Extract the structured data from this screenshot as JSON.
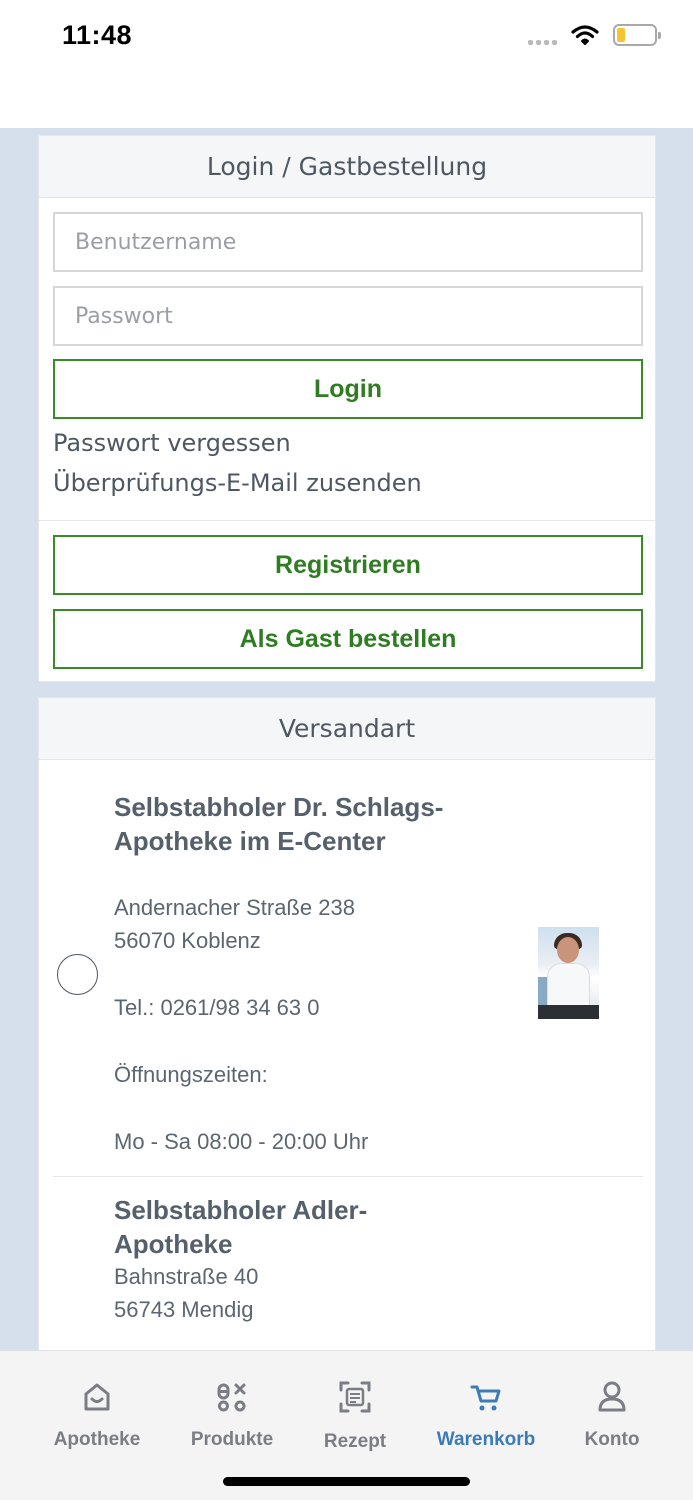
{
  "status_bar": {
    "time": "11:48"
  },
  "login": {
    "title": "Login / Gastbestellung",
    "username_placeholder": "Benutzername",
    "password_placeholder": "Passwort",
    "login_label": "Login",
    "forgot_password": "Passwort vergessen",
    "resend_verification": "Überprüfungs-E-Mail zusenden",
    "register_label": "Registrieren",
    "guest_label": "Als Gast bestellen"
  },
  "shipping": {
    "title": "Versandart",
    "options": [
      {
        "title": "Selbstabholer Dr. Schlags-Apotheke im E-Center",
        "street": "Andernacher Straße 238",
        "city": "56070 Koblenz",
        "phone": "Tel.: 0261/98 34 63 0",
        "hours_label": "Öffnungszeiten:",
        "hours": "Mo - Sa 08:00 - 20:00 Uhr"
      },
      {
        "title": "Selbstabholer Adler-Apotheke",
        "street": "Bahnstraße 40",
        "city": "56743 Mendig"
      }
    ]
  },
  "tabs": [
    {
      "label": "Apotheke",
      "icon": "pharmacy-icon"
    },
    {
      "label": "Produkte",
      "icon": "products-icon"
    },
    {
      "label": "Rezept",
      "icon": "prescription-scan-icon"
    },
    {
      "label": "Warenkorb",
      "icon": "cart-icon",
      "active": true
    },
    {
      "label": "Konto",
      "icon": "account-icon"
    }
  ],
  "colors": {
    "accent_green": "#2f7d22",
    "active_tab": "#3b7bb8",
    "background": "#d6e0ec"
  }
}
